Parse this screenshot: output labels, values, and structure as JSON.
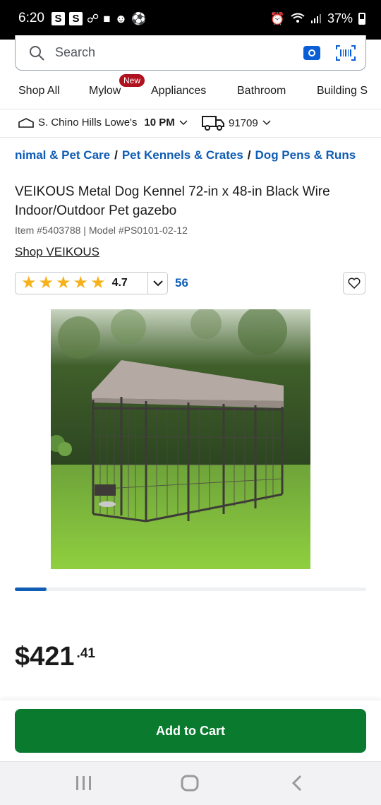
{
  "status_bar": {
    "time": "6:20",
    "left_badges": [
      "S",
      "S"
    ],
    "battery": "37%"
  },
  "search": {
    "placeholder": "Search"
  },
  "categories": [
    {
      "label": "Shop All"
    },
    {
      "label": "Mylow",
      "badge": "New"
    },
    {
      "label": "Appliances"
    },
    {
      "label": "Bathroom"
    },
    {
      "label": "Building S"
    }
  ],
  "store": {
    "name": "S. Chino Hills Lowe's",
    "hours": "10 PM",
    "zip": "91709"
  },
  "breadcrumb": [
    "nimal & Pet Care",
    "Pet Kennels & Crates",
    "Dog Pens & Runs"
  ],
  "product": {
    "title": "VEIKOUS Metal Dog Kennel 72-in x 48-in Black Wire Indoor/Outdoor Pet gazebo",
    "item_number": "Item #5403788 |",
    "model_number": "Model #PS0101-02-12",
    "brand_link": "Shop VEIKOUS",
    "rating": "4.7",
    "review_count": "56",
    "price_dollars": "$421",
    "price_cents": ".41",
    "carousel_progress": 0.09
  },
  "actions": {
    "add_to_cart": "Add to Cart"
  },
  "colors": {
    "brand_blue": "#0f5db4",
    "cta_green": "#0a7a2f",
    "star": "#f6b21b",
    "badge_red": "#b0121f"
  }
}
